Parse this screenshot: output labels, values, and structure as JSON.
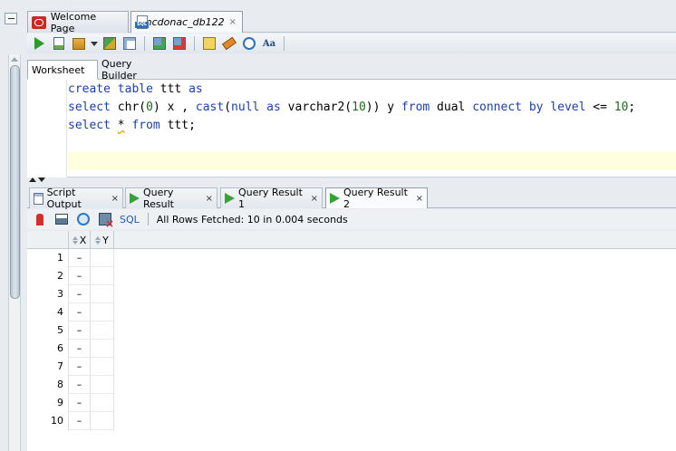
{
  "doc_tabs": [
    {
      "label": "Welcome Page",
      "icon": "oracle-logo-icon"
    },
    {
      "label": "mcdonac_db122",
      "icon": "sql-worksheet-icon",
      "close": "×"
    }
  ],
  "main_toolbar": {
    "icons": [
      "run-statement-icon",
      "run-script-icon",
      "commands-icon",
      "explain-plan-icon",
      "autotrace-icon",
      "commit-icon",
      "rollback-icon",
      "sql-tuning-icon",
      "clear-icon",
      "sql-history-icon",
      "to-upper-lower-icon"
    ],
    "case_label": "Aa"
  },
  "worksheet_tabs": [
    "Worksheet",
    "Query Builder"
  ],
  "editor": {
    "lines": [
      {
        "kw1": "create table",
        "plain1": " ttt ",
        "kw2": "as"
      },
      {
        "kw1": "select",
        "plain1": " chr(",
        "n1": "0",
        "plain2": ") x , ",
        "kw2": "cast",
        "plain3": "(",
        "kw3": "null as",
        "plain4": " varchar2(",
        "n2": "10",
        "plain5": ")) y ",
        "kw4": "from",
        "plain6": " dual ",
        "kw5": "connect by level",
        "plain7": " <= ",
        "n3": "10",
        "plain8": ";"
      },
      {
        "kw1": "select",
        "plain1": " ",
        "star": "*",
        "plain2": " ",
        "kw2": "from",
        "plain3": " ttt;"
      }
    ]
  },
  "result_tabs": [
    {
      "label": "Script Output",
      "close": "×"
    },
    {
      "label": "Query Result",
      "close": "×"
    },
    {
      "label": "Query Result 1",
      "close": "×"
    },
    {
      "label": "Query Result 2",
      "close": "×",
      "active": true
    }
  ],
  "result_toolbar": {
    "sql_label": "SQL",
    "status": "All Rows Fetched: 10 in 0.004 seconds"
  },
  "grid": {
    "columns": [
      "X",
      "Y"
    ],
    "rows": [
      {
        "n": "1",
        "x": "–",
        "y": ""
      },
      {
        "n": "2",
        "x": "–",
        "y": ""
      },
      {
        "n": "3",
        "x": "–",
        "y": ""
      },
      {
        "n": "4",
        "x": "–",
        "y": ""
      },
      {
        "n": "5",
        "x": "–",
        "y": ""
      },
      {
        "n": "6",
        "x": "–",
        "y": ""
      },
      {
        "n": "7",
        "x": "–",
        "y": ""
      },
      {
        "n": "8",
        "x": "–",
        "y": ""
      },
      {
        "n": "9",
        "x": "–",
        "y": ""
      },
      {
        "n": "10",
        "x": "–",
        "y": ""
      }
    ]
  }
}
